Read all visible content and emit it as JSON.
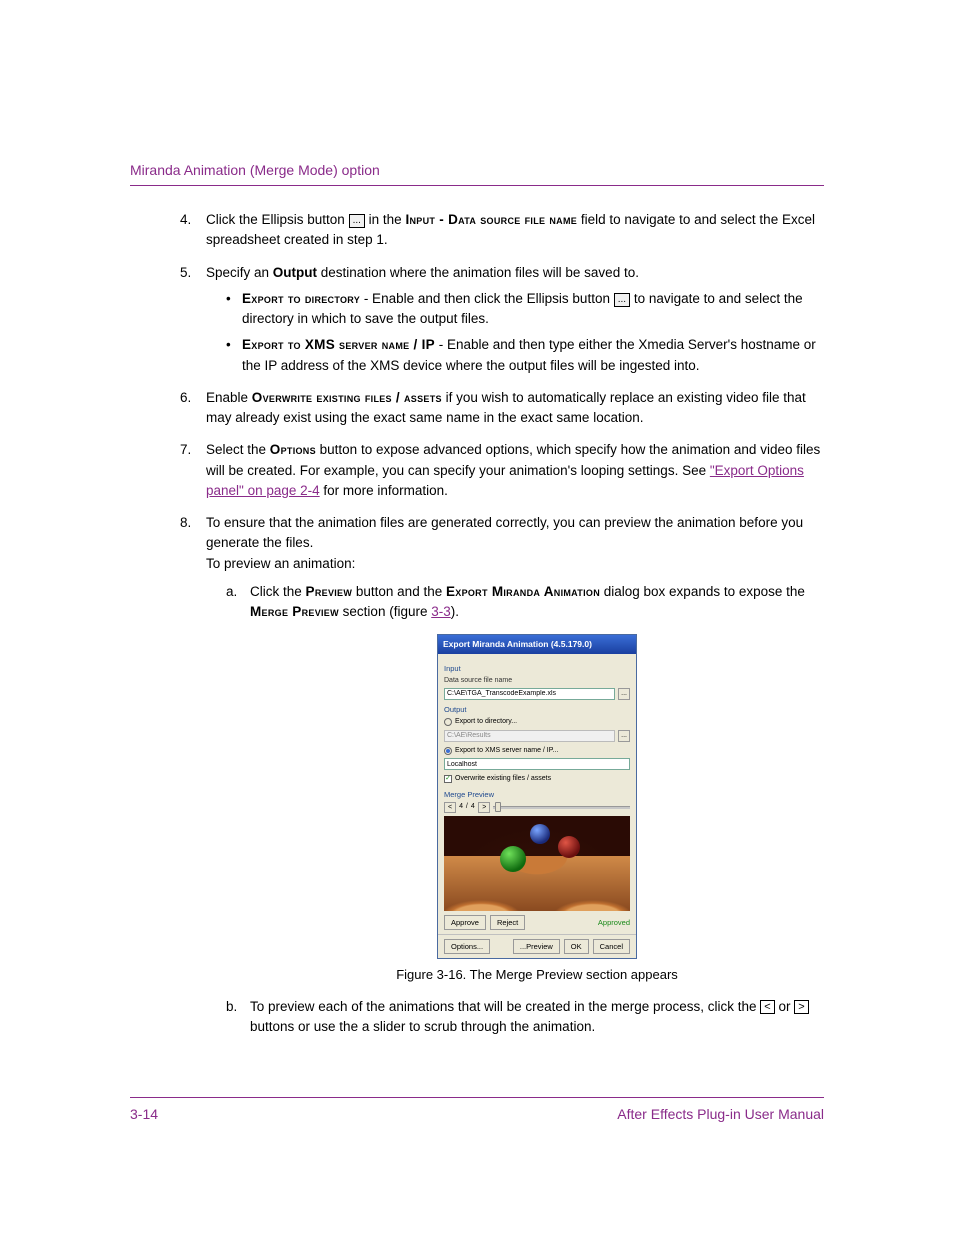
{
  "header": {
    "title": "Miranda Animation (Merge Mode) option"
  },
  "steps": {
    "s4": {
      "num": "4.",
      "pre": "Click the Ellipsis button ",
      "mid": " in the ",
      "field_caps": "Input - Data source file name",
      "post": " field to navigate to and select the Excel spreadsheet created in step 1."
    },
    "s5": {
      "num": "5.",
      "pre": "Specify an ",
      "bold": "Output",
      "post": " destination where the animation files will be saved to.",
      "b1": {
        "caps": "Export to directory",
        "dash": " - Enable and then click the Ellipsis button ",
        "post": " to navigate to and select the directory in which to save the output files."
      },
      "b2": {
        "caps": "Export to XMS server name / IP",
        "text": " - Enable and then type either the Xmedia Server's hostname or the IP address of the XMS device where the output files will be ingested into."
      }
    },
    "s6": {
      "num": "6.",
      "pre": "Enable ",
      "caps": "Overwrite existing files / assets",
      "post": " if you wish to automatically replace an existing video file that may already exist using the exact same name in the exact same location."
    },
    "s7": {
      "num": "7.",
      "pre": "Select the ",
      "caps": "Options",
      "mid": " button to expose advanced options, which specify how the animation and video files will be created. For example, you can specify your animation's looping settings. See ",
      "link": "\"Export Options panel\" on page 2-4",
      "post": " for more information."
    },
    "s8": {
      "num": "8.",
      "text": "To ensure that the animation files are generated correctly, you can preview the animation before you generate the files.",
      "text2": "To preview an animation:",
      "a": {
        "lett": "a.",
        "pre": "Click the ",
        "caps1": "Preview",
        "mid1": " button and the ",
        "caps2": "Export Miranda Animation",
        "mid2": " dialog box expands to expose the ",
        "caps3": "Merge Preview",
        "mid3": " section (figure ",
        "link": "3-3",
        "post": ")."
      },
      "b": {
        "lett": "b.",
        "pre": "To preview each of the animations that will be created in the merge process, click the ",
        "or": " or ",
        "post": " buttons or use the a slider to scrub through the animation."
      }
    }
  },
  "icons": {
    "ellipsis": "...",
    "prev": "<",
    "next": ">"
  },
  "dialog": {
    "title": "Export Miranda Animation (4.5.179.0)",
    "section_input": "Input",
    "label_datasrc": "Data source file name",
    "val_datasrc": "C:\\AE\\TGA_TranscodeExample.xls",
    "section_output": "Output",
    "radio_dir": "Export to directory...",
    "val_dir": "C:\\AE\\Results",
    "radio_xms": "Export to XMS server name / IP...",
    "val_xms": "Localhost",
    "check_over": "Overwrite existing files / assets",
    "section_merge": "Merge Preview",
    "count": "4 / 4",
    "btn_approve": "Approve",
    "btn_reject": "Reject",
    "approved": "Approved",
    "btn_options": "Options...",
    "btn_preview": "...Preview",
    "btn_ok": "OK",
    "btn_cancel": "Cancel"
  },
  "figure": {
    "caption": "Figure 3-16. The Merge Preview section appears"
  },
  "footer": {
    "page": "3-14",
    "manual": "After Effects Plug-in User Manual"
  }
}
